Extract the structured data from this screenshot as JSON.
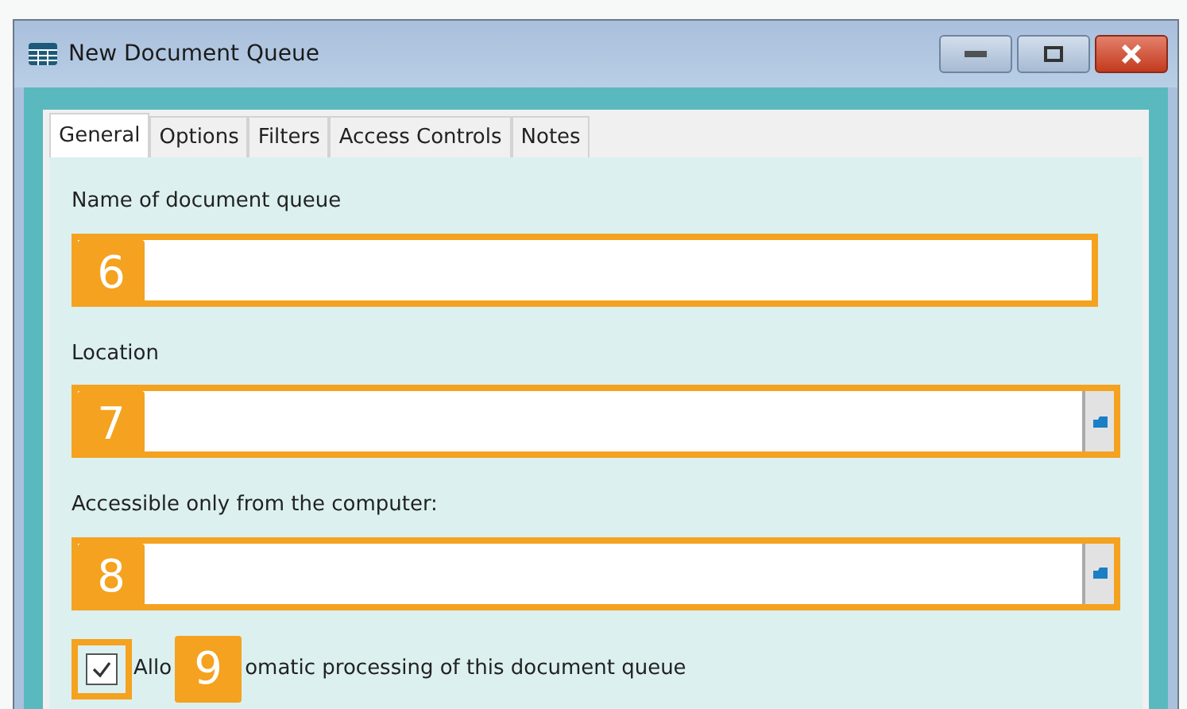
{
  "window": {
    "title": "New Document Queue"
  },
  "tabs": [
    {
      "label": "General",
      "selected": true
    },
    {
      "label": "Options",
      "selected": false
    },
    {
      "label": "Filters",
      "selected": false
    },
    {
      "label": "Access Controls",
      "selected": false
    },
    {
      "label": "Notes",
      "selected": false
    }
  ],
  "fields": [
    {
      "label": "Name of document queue",
      "kind": "text",
      "callout": "6"
    },
    {
      "label": "Location",
      "kind": "browse",
      "callout": "7"
    },
    {
      "label": "Accessible only from the computer:",
      "kind": "browse",
      "callout": "8"
    }
  ],
  "checkbox": {
    "label_parts": [
      "Allo",
      "omatic processing of this document queue"
    ],
    "checked": true,
    "callout": "9"
  }
}
